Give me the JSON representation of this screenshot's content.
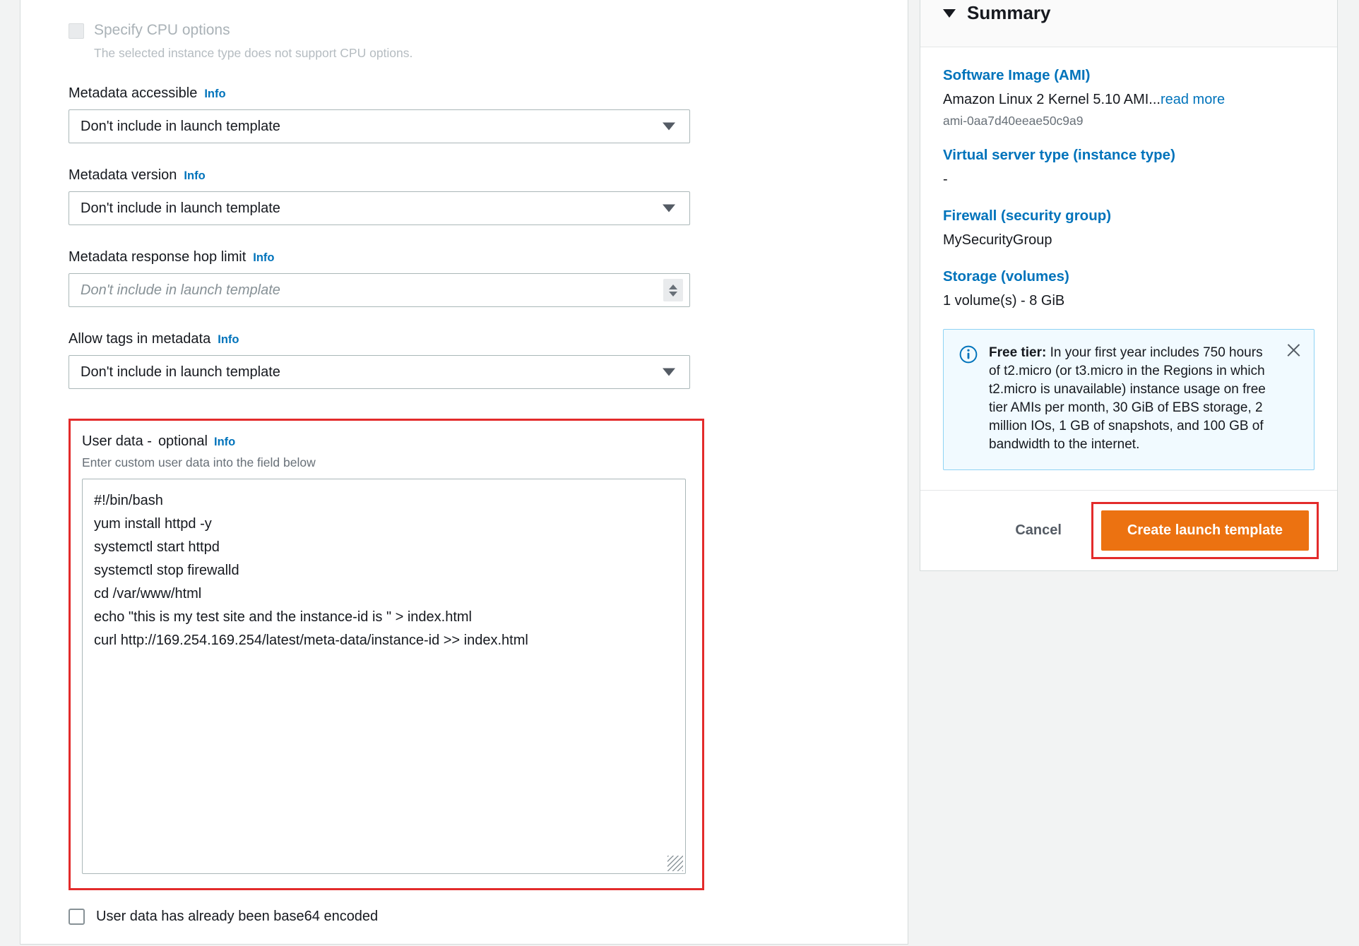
{
  "cpu": {
    "label": "Specify CPU options",
    "sub": "The selected instance type does not support CPU options."
  },
  "info_label": "Info",
  "fields": [
    {
      "label": "Metadata accessible",
      "value": "Don't include in launch template"
    },
    {
      "label": "Metadata version",
      "value": "Don't include in launch template"
    },
    {
      "label": "Metadata response hop limit",
      "placeholder": "Don't include in launch template"
    },
    {
      "label": "Allow tags in metadata",
      "value": "Don't include in launch template"
    }
  ],
  "user_data": {
    "label": "User data -",
    "optional": "optional",
    "sub": "Enter custom user data into the field below",
    "script_lines": [
      "#!/bin/bash",
      "yum install httpd -y",
      "systemctl start httpd",
      "systemctl stop firewalld",
      "cd /var/www/html",
      "echo \"this is my test site and the instance-id is \" > index.html",
      "curl http://169.254.169.254/latest/meta-data/instance-id >> index.html"
    ],
    "base64_checkbox_label": "User data has already been base64 encoded"
  },
  "summary": {
    "title": "Summary",
    "blocks": [
      {
        "link": "Software Image (AMI)",
        "value": "Amazon Linux 2 Kernel 5.10 AMI...",
        "read_more": "read more",
        "sub": "ami-0aa7d40eeae50c9a9"
      },
      {
        "link": "Virtual server type (instance type)",
        "value": "-"
      },
      {
        "link": "Firewall (security group)",
        "value": "MySecurityGroup"
      },
      {
        "link": "Storage (volumes)",
        "value": "1 volume(s) - 8 GiB"
      }
    ],
    "alert": {
      "bold": "Free tier:",
      "text": " In your first year includes 750 hours of t2.micro (or t3.micro in the Regions in which t2.micro is unavailable) instance usage on free tier AMIs per month, 30 GiB of EBS storage, 2 million IOs, 1 GB of snapshots, and 100 GB of bandwidth to the internet."
    },
    "cancel_label": "Cancel",
    "create_label": "Create launch template"
  },
  "colors": {
    "accent_link": "#0073bb",
    "button_orange": "#ec7211",
    "highlight_red": "#e32b2b",
    "alert_bg": "#f1faff"
  }
}
